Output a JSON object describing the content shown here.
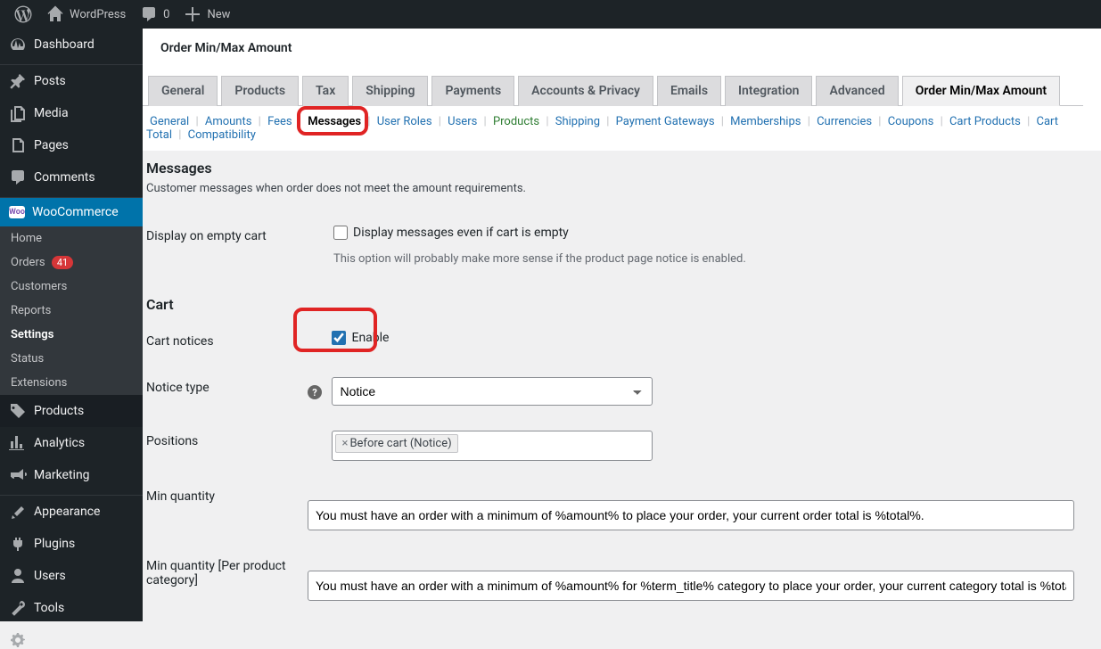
{
  "adminbar": {
    "site_name": "WordPress",
    "comments_count": "0",
    "new_label": "New"
  },
  "adminmenu": {
    "dashboard": "Dashboard",
    "posts": "Posts",
    "media": "Media",
    "pages": "Pages",
    "comments": "Comments",
    "woocommerce": "WooCommerce",
    "wc_sub": {
      "home": "Home",
      "orders": "Orders",
      "orders_count": "41",
      "customers": "Customers",
      "reports": "Reports",
      "settings": "Settings",
      "status": "Status",
      "extensions": "Extensions"
    },
    "products": "Products",
    "analytics": "Analytics",
    "marketing": "Marketing",
    "appearance": "Appearance",
    "plugins": "Plugins",
    "users": "Users",
    "tools": "Tools",
    "settings": "Settings"
  },
  "page": {
    "title": "Order Min/Max Amount"
  },
  "tabs": [
    "General",
    "Products",
    "Tax",
    "Shipping",
    "Payments",
    "Accounts & Privacy",
    "Emails",
    "Integration",
    "Advanced",
    "Order Min/Max Amount"
  ],
  "tabs_active_index": 9,
  "subtabs": [
    {
      "label": "General"
    },
    {
      "label": "Amounts"
    },
    {
      "label": "Fees"
    },
    {
      "label": "Messages",
      "current": true
    },
    {
      "label": "User Roles"
    },
    {
      "label": "Users"
    },
    {
      "label": "Products",
      "green": true
    },
    {
      "label": "Shipping"
    },
    {
      "label": "Payment Gateways"
    },
    {
      "label": "Memberships"
    },
    {
      "label": "Currencies"
    },
    {
      "label": "Coupons"
    },
    {
      "label": "Cart Products"
    },
    {
      "label": "Cart Total"
    },
    {
      "label": "Compatibility"
    }
  ],
  "sections": {
    "messages": {
      "heading": "Messages",
      "desc": "Customer messages when order does not meet the amount requirements."
    },
    "display_empty": {
      "label": "Display on empty cart",
      "checkbox_label": "Display messages even if cart is empty",
      "description": "This option will probably make more sense if the product page notice is enabled."
    },
    "cart": {
      "heading": "Cart"
    },
    "cart_notices": {
      "label": "Cart notices",
      "checkbox_label": "Enable"
    },
    "notice_type": {
      "label": "Notice type",
      "value": "Notice"
    },
    "positions": {
      "label": "Positions",
      "token": "Before cart (Notice)"
    },
    "min_qty": {
      "label": "Min quantity",
      "value": "You must have an order with a minimum of %amount% to place your order, your current order total is %total%."
    },
    "min_qty_cat": {
      "label": "Min quantity [Per product category]",
      "value": "You must have an order with a minimum of %amount% for %term_title% category to place your order, your current category total is %total%."
    }
  }
}
